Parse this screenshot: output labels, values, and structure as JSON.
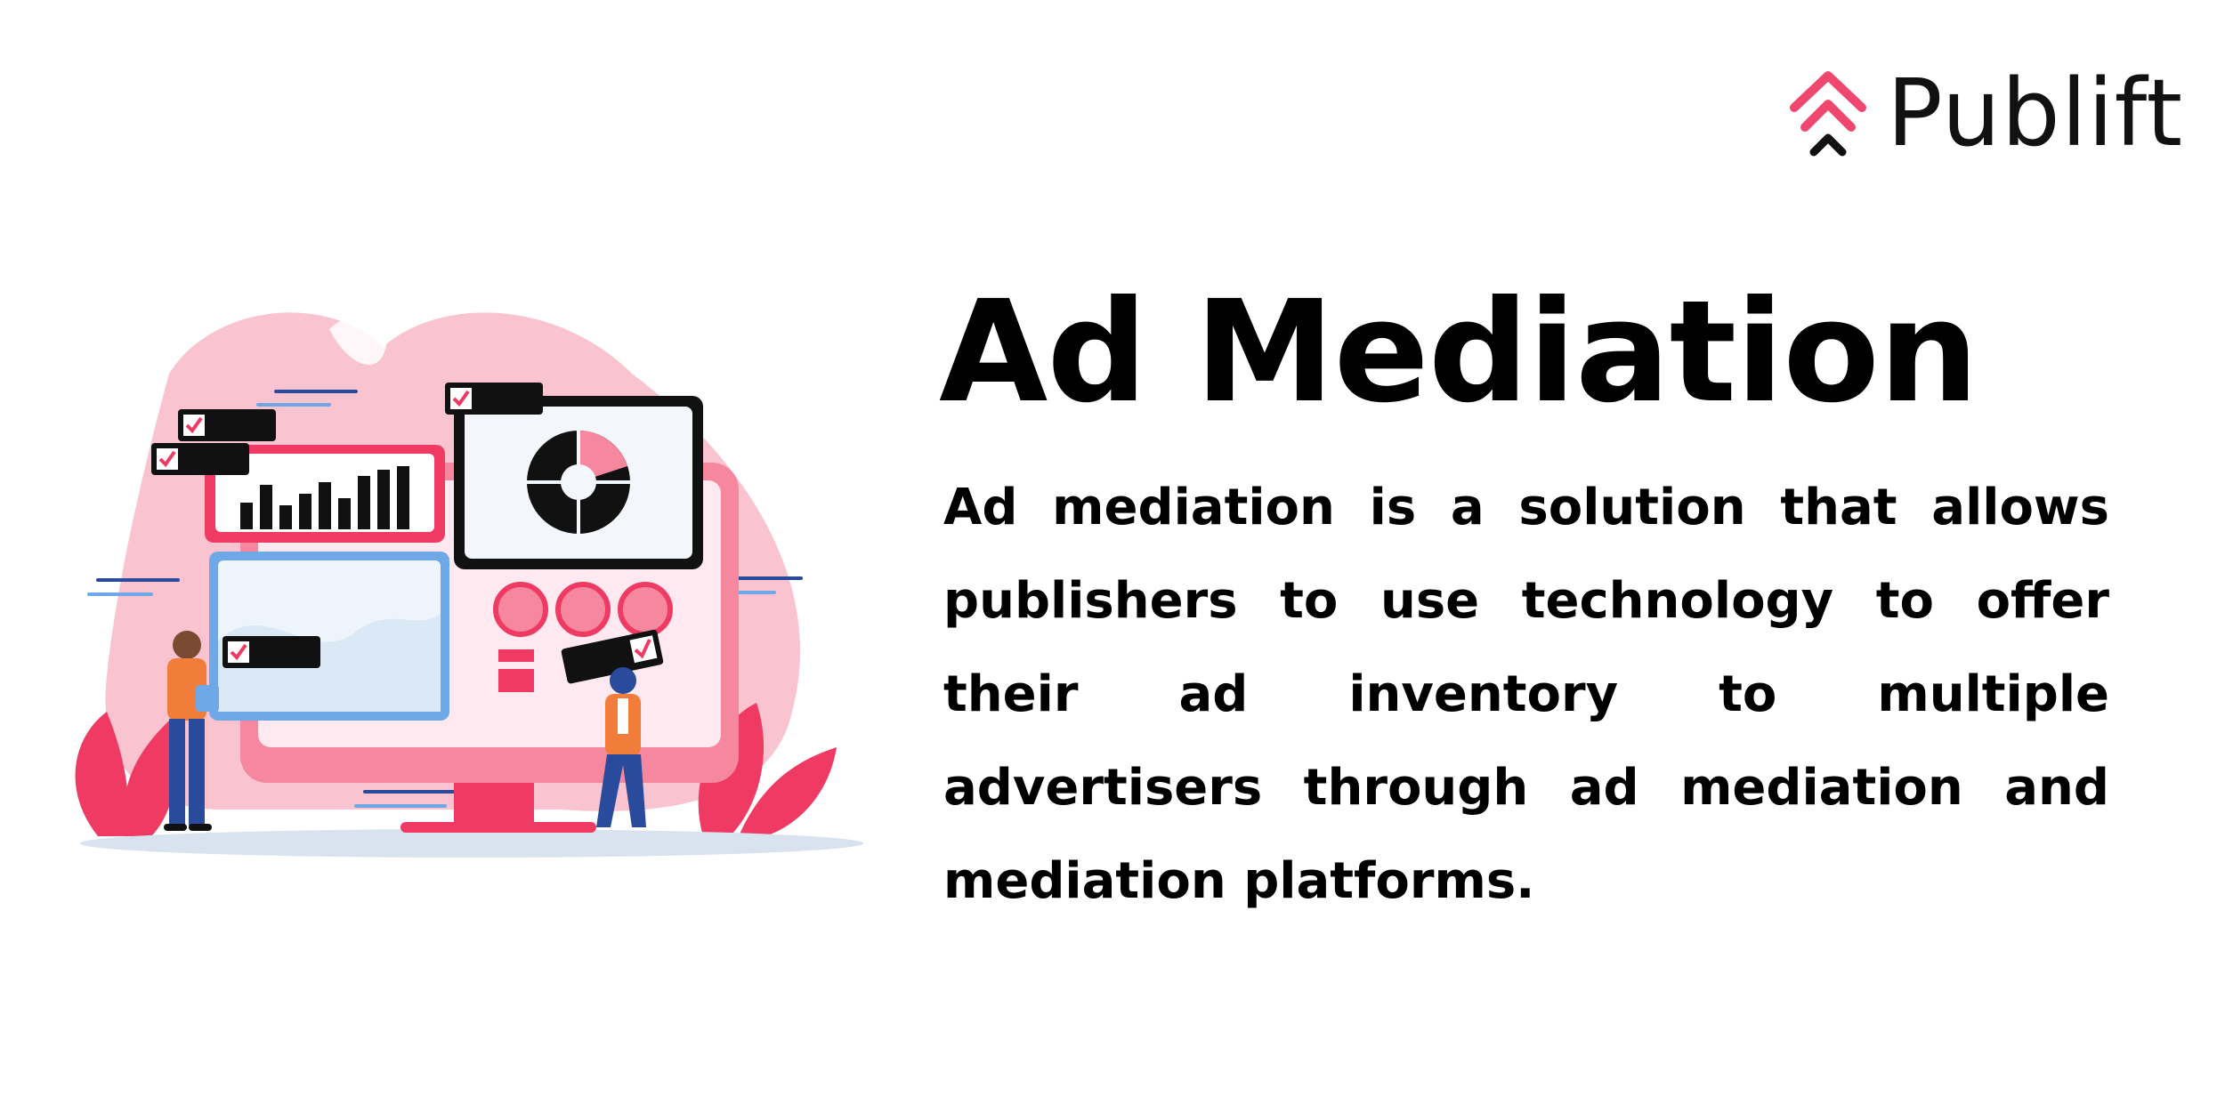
{
  "brand": {
    "name": "Publift",
    "logo_icon": "double-chevron-up-icon",
    "accent_color": "#f0476f"
  },
  "heading": {
    "title": "Ad Mediation",
    "description": "Ad mediation is a solution that allows publishers to use technology to offer their ad inventory to multiple advertisers through ad mediation and mediation platforms."
  },
  "illustration": {
    "subject": "people-reviewing-dashboard-illustration",
    "colors": {
      "pink_light": "#f9b9c8",
      "pink": "#f5889f",
      "red": "#ef3b63",
      "blue": "#6fa8e6",
      "navy": "#2a4b9b",
      "orange": "#f27c3a",
      "dark": "#111111"
    }
  }
}
